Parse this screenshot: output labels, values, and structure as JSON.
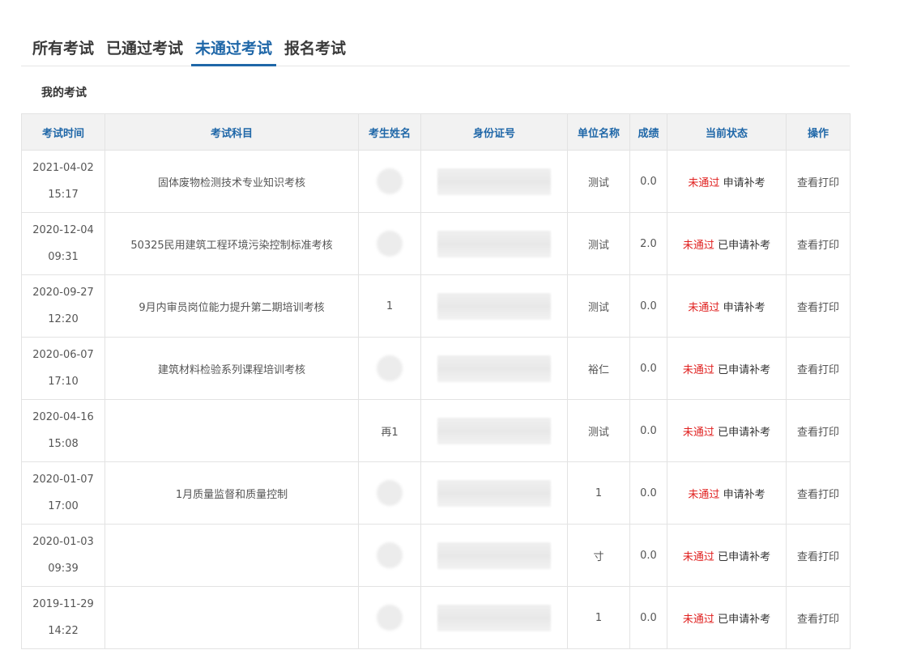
{
  "tabs": [
    {
      "label": "所有考试"
    },
    {
      "label": "已通过考试"
    },
    {
      "label": "未通过考试",
      "active": true
    },
    {
      "label": "报名考试"
    }
  ],
  "section_title": "我的考试",
  "table": {
    "headers": [
      "考试时间",
      "考试科目",
      "考生姓名",
      "身份证号",
      "单位名称",
      "成绩",
      "当前状态",
      "操作"
    ],
    "rows": [
      {
        "date": "2021-04-02",
        "time": "15:17",
        "subject": "固体废物检测技术专业知识考核",
        "name": "",
        "unit": "测试",
        "score": "0.0",
        "status": "未通过",
        "status_extra": "申请补考",
        "action": "查看打印"
      },
      {
        "date": "2020-12-04",
        "time": "09:31",
        "subject": "50325民用建筑工程环境污染控制标准考核",
        "name": "",
        "unit": "测试",
        "score": "2.0",
        "status": "未通过",
        "status_extra": "已申请补考",
        "action": "查看打印"
      },
      {
        "date": "2020-09-27",
        "time": "12:20",
        "subject": "9月内审员岗位能力提升第二期培训考核",
        "name": "1",
        "unit": "测试",
        "score": "0.0",
        "status": "未通过",
        "status_extra": "申请补考",
        "action": "查看打印"
      },
      {
        "date": "2020-06-07",
        "time": "17:10",
        "subject": "建筑材料检验系列课程培训考核",
        "name": "",
        "unit": "裕仁",
        "score": "0.0",
        "status": "未通过",
        "status_extra": "已申请补考",
        "action": "查看打印"
      },
      {
        "date": "2020-04-16",
        "time": "15:08",
        "subject": "",
        "name": "再1",
        "unit": "测试",
        "score": "0.0",
        "status": "未通过",
        "status_extra": "已申请补考",
        "action": "查看打印"
      },
      {
        "date": "2020-01-07",
        "time": "17:00",
        "subject": "1月质量监督和质量控制",
        "name": "",
        "unit": "1",
        "score": "0.0",
        "status": "未通过",
        "status_extra": "申请补考",
        "action": "查看打印"
      },
      {
        "date": "2020-01-03",
        "time": "09:39",
        "subject": "",
        "name": "",
        "unit": "寸",
        "score": "0.0",
        "status": "未通过",
        "status_extra": "已申请补考",
        "action": "查看打印"
      },
      {
        "date": "2019-11-29",
        "time": "14:22",
        "subject": "",
        "name": "",
        "unit": "1",
        "score": "0.0",
        "status": "未通过",
        "status_extra": "已申请补考",
        "action": "查看打印"
      }
    ]
  }
}
